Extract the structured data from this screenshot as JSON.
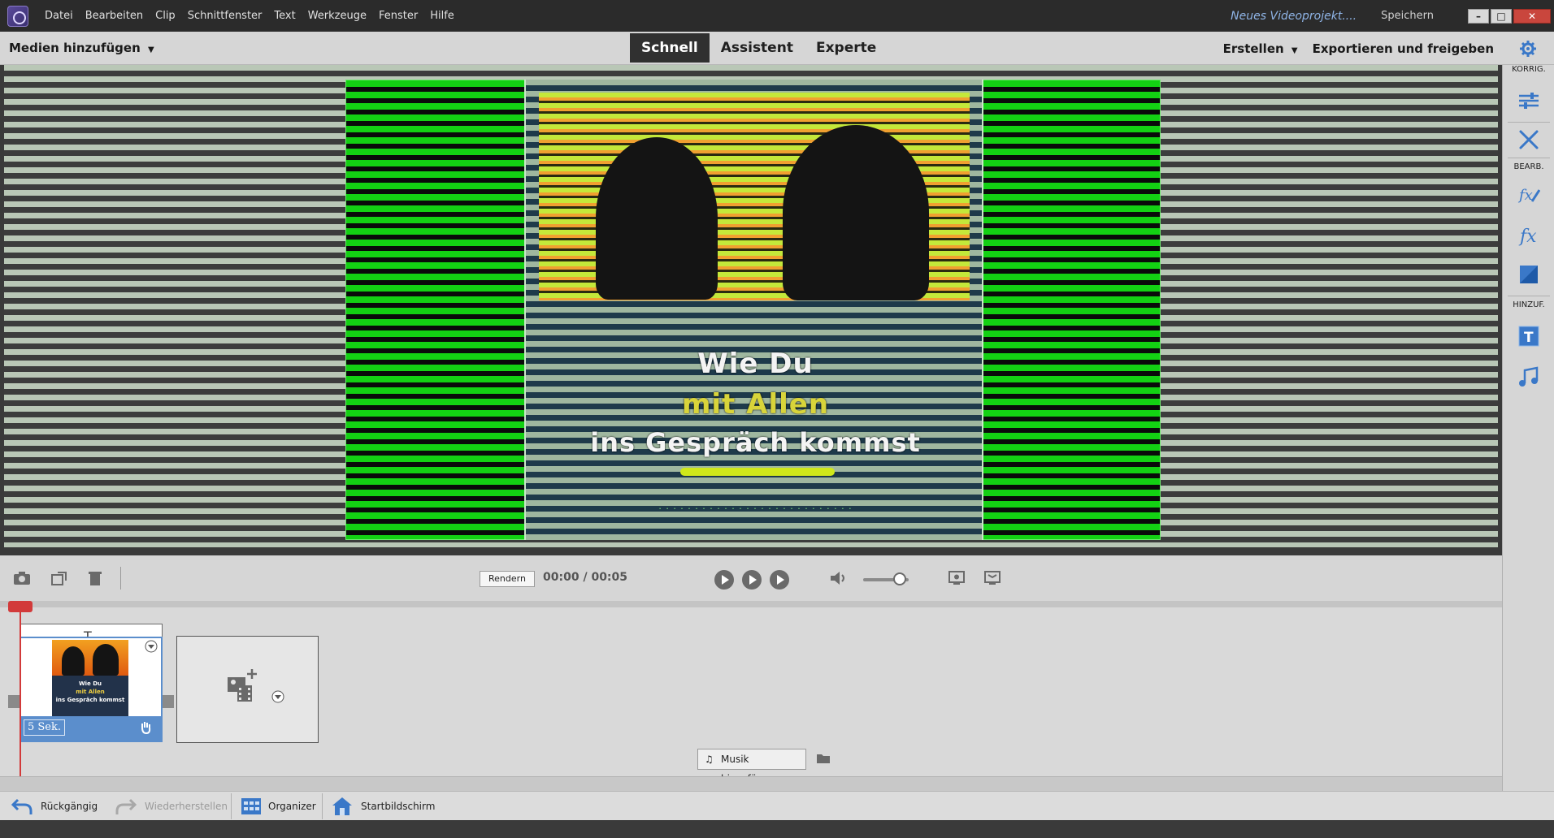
{
  "menu": {
    "items": [
      "Datei",
      "Bearbeiten",
      "Clip",
      "Schnittfenster",
      "Text",
      "Werkzeuge",
      "Fenster",
      "Hilfe"
    ]
  },
  "title": {
    "project": "Neues Videoprojekt....",
    "save": "Speichern"
  },
  "toolbar": {
    "add_media": "Medien hinzufügen",
    "tabs": [
      "Schnell",
      "Assistent",
      "Experte"
    ],
    "active_tab": "Schnell",
    "create": "Erstellen",
    "export": "Exportieren und freigeben"
  },
  "preview": {
    "line1": "Wie Du",
    "line2": "mit Allen",
    "line3": "ins Gespräch kommst"
  },
  "right_panel": {
    "sections": [
      "KORRIG.",
      "BEARB.",
      "HINZUF."
    ],
    "icons": [
      "adjust-sliders-icon",
      "tools-icon",
      "fx-edit-icon",
      "fx-icon",
      "color-icon",
      "title-text-icon",
      "music-note-icon"
    ]
  },
  "controls": {
    "render": "Rendern",
    "current_time": "00:00",
    "separator": "/",
    "total_time": "00:05",
    "volume": 0.8
  },
  "timeline": {
    "clip": {
      "duration": "5 Sek.",
      "thumb_line1": "Wie Du",
      "thumb_line2": "mit Allen",
      "thumb_line3": "ins Gespräch kommst"
    },
    "music_button": "Musik hinzufügen"
  },
  "bottom": {
    "undo": "Rückgängig",
    "redo": "Wiederherstellen",
    "organizer": "Organizer",
    "home": "Startbildschirm"
  },
  "colors": {
    "accent": "#5b8ecc",
    "playhead": "#d23a3a",
    "green_screen": "#13d113"
  }
}
